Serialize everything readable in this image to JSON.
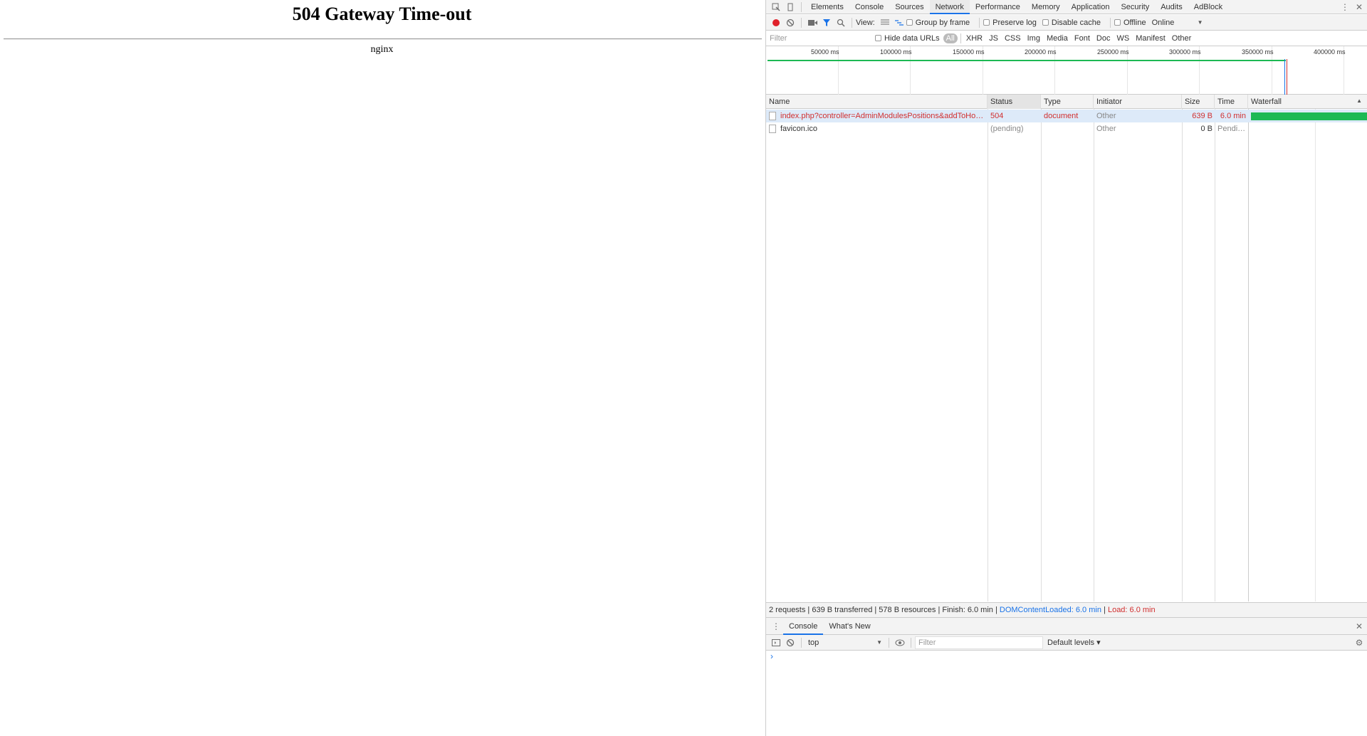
{
  "page": {
    "heading": "504 Gateway Time-out",
    "server": "nginx"
  },
  "devtools": {
    "tabs": [
      "Elements",
      "Console",
      "Sources",
      "Network",
      "Performance",
      "Memory",
      "Application",
      "Security",
      "Audits",
      "AdBlock"
    ],
    "active_tab": "Network",
    "toolbar": {
      "view_label": "View:",
      "group_by_frame": "Group by frame",
      "preserve_log": "Preserve log",
      "disable_cache": "Disable cache",
      "offline": "Offline",
      "throttle": "Online"
    },
    "filter_bar": {
      "placeholder": "Filter",
      "hide_data_urls": "Hide data URLs",
      "types": [
        "All",
        "XHR",
        "JS",
        "CSS",
        "Img",
        "Media",
        "Font",
        "Doc",
        "WS",
        "Manifest",
        "Other"
      ],
      "selected_type": "All"
    },
    "overview_ticks": [
      "50000 ms",
      "100000 ms",
      "150000 ms",
      "200000 ms",
      "250000 ms",
      "300000 ms",
      "350000 ms",
      "400000 ms"
    ],
    "columns": [
      "Name",
      "Status",
      "Type",
      "Initiator",
      "Size",
      "Time",
      "Waterfall"
    ],
    "requests": [
      {
        "name": "index.php?controller=AdminModulesPositions&addToHook&t...",
        "status": "504",
        "type": "document",
        "initiator": "Other",
        "size": "639 B",
        "time": "6.0 min",
        "error": true
      },
      {
        "name": "favicon.ico",
        "status": "(pending)",
        "type": "",
        "initiator": "Other",
        "size": "0 B",
        "time": "Pending",
        "error": false
      }
    ],
    "summary": {
      "text": "2 requests | 639 B transferred | 578 B resources | Finish: 6.0 min | ",
      "dcl": "DOMContentLoaded: 6.0 min",
      "pipe": " | ",
      "load": "Load: 6.0 min"
    },
    "drawer": {
      "tabs": [
        "Console",
        "What's New"
      ],
      "context": "top",
      "filter_placeholder": "Filter",
      "levels": "Default levels ▾",
      "prompt": "›"
    },
    "colors": {
      "accent": "#1a73e8",
      "error": "#d12f2f",
      "waterfall": "#1db954"
    }
  }
}
